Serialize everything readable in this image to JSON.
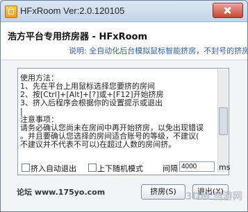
{
  "window": {
    "title": "HFxRoom  Ver:2.0.120105"
  },
  "header": {
    "title": "浩方平台专用挤房器 - HFxRoom",
    "description": "说明: 全自动化后台模拟鼠标智能挤房，不封号的挤房器。"
  },
  "content": {
    "lines": [
      "使用方法：",
      "1、先在平台上用鼠标选择您要挤的房间",
      "2、按[Ctrl]+[Alt]+[?]或+[F12]开始挤房",
      "3、挤入后程序会根据你的设置提示或退出",
      "|",
      "注意事项：",
      "请务必确认您尚未在房间中再开始挤房，以免出现错误",
      "。并且要确认您选择的房间适合账号的等级，不建议(",
      "不建议并不代表不可以)在超过人数的房间挤。"
    ]
  },
  "options": {
    "auto_exit_label": "挤入自动退出",
    "random_mode_label": "上下随机模式",
    "interval_label": "间隔",
    "interval_value": "4000",
    "unit": "ms"
  },
  "footer": {
    "site": "论坛  www.175yo.com",
    "start_button": "挤房(S)",
    "exit_button": "退出(X)"
  },
  "watermark": {
    "text": "3DM 当游网"
  }
}
